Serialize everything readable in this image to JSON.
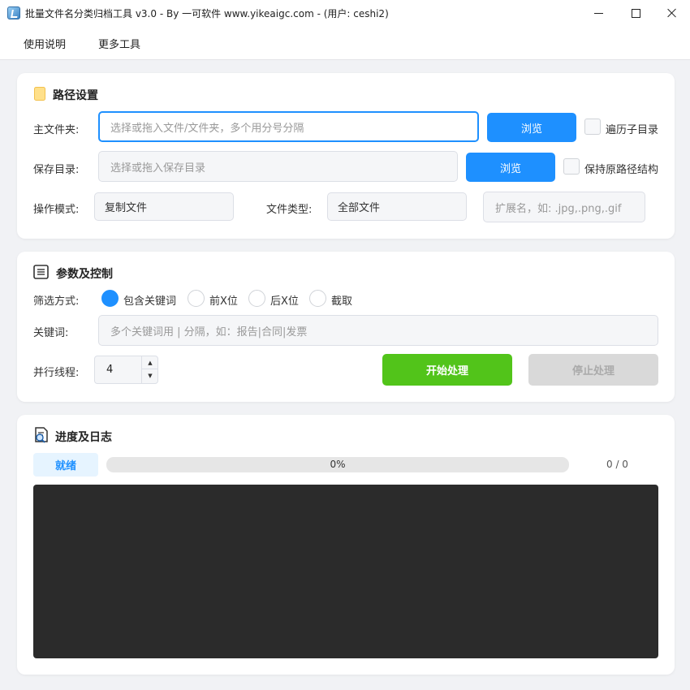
{
  "window": {
    "title": "批量文件名分类归档工具 v3.0 - By 一可软件 www.yikeaigc.com - (用户: ceshi2)"
  },
  "menu": {
    "items": [
      "使用说明",
      "更多工具"
    ]
  },
  "path_settings": {
    "title": "路径设置",
    "icon": "folder-icon",
    "main_folder_label": "主文件夹:",
    "main_folder_placeholder": "选择或拖入文件/文件夹，多个用分号分隔",
    "browse_label": "浏览",
    "recursive_label": "遍历子目录",
    "save_dir_label": "保存目录:",
    "save_dir_placeholder": "选择或拖入保存目录",
    "keep_structure_label": "保持原路径结构",
    "mode_label": "操作模式:",
    "mode_value": "复制文件",
    "file_type_label": "文件类型:",
    "file_type_value": "全部文件",
    "ext_placeholder": "扩展名，如: .jpg,.png,.gif"
  },
  "params": {
    "title": "参数及控制",
    "icon": "list-icon",
    "filter_label": "筛选方式:",
    "filter_options": [
      "包含关键词",
      "前X位",
      "后X位",
      "截取"
    ],
    "filter_selected": "包含关键词",
    "keyword_label": "关键词:",
    "keyword_placeholder": "多个关键词用 | 分隔，如：报告|合同|发票",
    "threads_label": "并行线程:",
    "threads_value": "4",
    "start_label": "开始处理",
    "stop_label": "停止处理"
  },
  "progress": {
    "title": "进度及日志",
    "icon": "log-search-icon",
    "status": "就绪",
    "percent_text": "0%",
    "percent": 0,
    "count_text": "0 / 0"
  },
  "colors": {
    "accent": "#1e90ff",
    "start": "#52c41a",
    "disabled": "#d9d9d9",
    "log_bg": "#2b2b2b"
  }
}
